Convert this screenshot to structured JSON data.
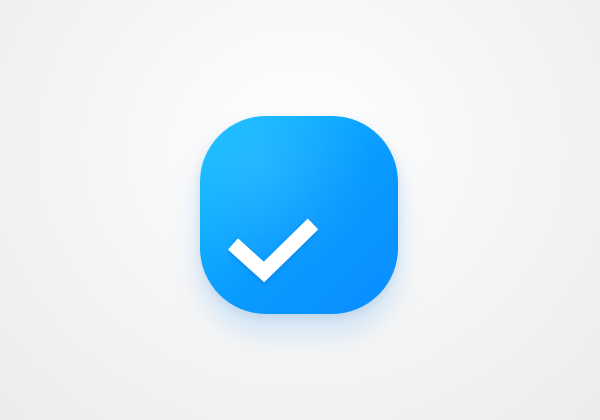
{
  "app_icon": {
    "icon": "checkmark-icon",
    "colors": {
      "gradient_start": "#13c0ff",
      "gradient_end": "#0a8cff",
      "check": "#ffffff",
      "background": "#f2f2f2"
    }
  }
}
